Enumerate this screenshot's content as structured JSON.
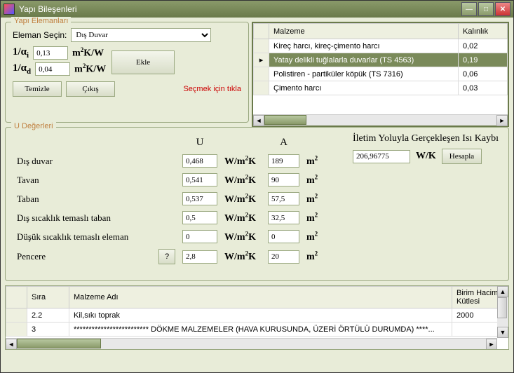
{
  "window": {
    "title": "Yapı Bileşenleri"
  },
  "elemanlar": {
    "legend": "Yapı Elemanları",
    "eleman_secin_label": "Eleman Seçin:",
    "eleman_secin_value": "Dış Duvar",
    "alpha_i_label": "1/α",
    "alpha_i_sub": "i",
    "alpha_i_value": "0,13",
    "alpha_d_label": "1/α",
    "alpha_d_sub": "d",
    "alpha_d_value": "0,04",
    "unit_m2kw": "m²K/W",
    "ekle_label": "Ekle",
    "temizle_label": "Temizle",
    "cikis_label": "Çıkış",
    "hint": "Seçmek için tıkla"
  },
  "malzeme_table": {
    "col_malzeme": "Malzeme",
    "col_kalinlik": "Kalınlık",
    "rows": [
      {
        "malzeme": "Kireç harcı, kireç-çimento harcı",
        "kalinlik": "0,02"
      },
      {
        "malzeme": "Yatay delikli tuğlalarla duvarlar (TS 4563)",
        "kalinlik": "0,19",
        "selected": true
      },
      {
        "malzeme": "Polistiren - partiküler köpük (TS 7316)",
        "kalinlik": "0,06"
      },
      {
        "malzeme": "Çimento harcı",
        "kalinlik": "0,03"
      }
    ]
  },
  "u_degerleri": {
    "legend": "U Değerleri",
    "col_u": "U",
    "col_a": "A",
    "unit_wm2k": "W/m²K",
    "unit_m2": "m²",
    "rows": [
      {
        "label": "Dış duvar",
        "u": "0,468",
        "a": "189"
      },
      {
        "label": "Tavan",
        "u": "0,541",
        "a": "90"
      },
      {
        "label": "Taban",
        "u": "0,537",
        "a": "57,5"
      },
      {
        "label": "Dış sıcaklık temaslı taban",
        "u": "0,5",
        "a": "32,5"
      },
      {
        "label": "Düşük sıcaklık temaslı eleman",
        "u": "0",
        "a": "0"
      },
      {
        "label": "Pencere",
        "u": "2,8",
        "a": "20",
        "has_q": true
      }
    ],
    "q_label": "?",
    "heatloss_label": "İletim Yoluyla Gerçekleşen Isı Kaybı",
    "heatloss_value": "206,96775",
    "heatloss_unit": "W/K",
    "hesapla_label": "Hesapla"
  },
  "bottom_table": {
    "col_sira": "Sıra",
    "col_malzeme_adi": "Malzeme Adı",
    "col_birim": "Birim Hacim Kütlesi",
    "rows": [
      {
        "sira": "2.2",
        "adi": "Kil,sıkı toprak",
        "birim": "2000"
      },
      {
        "sira": "3",
        "adi": "************************* DÖKME MALZEMELER (HAVA KURUSUNDA, ÜZERİ ÖRTÜLÜ DURUMDA) ****...",
        "birim": ""
      }
    ]
  }
}
